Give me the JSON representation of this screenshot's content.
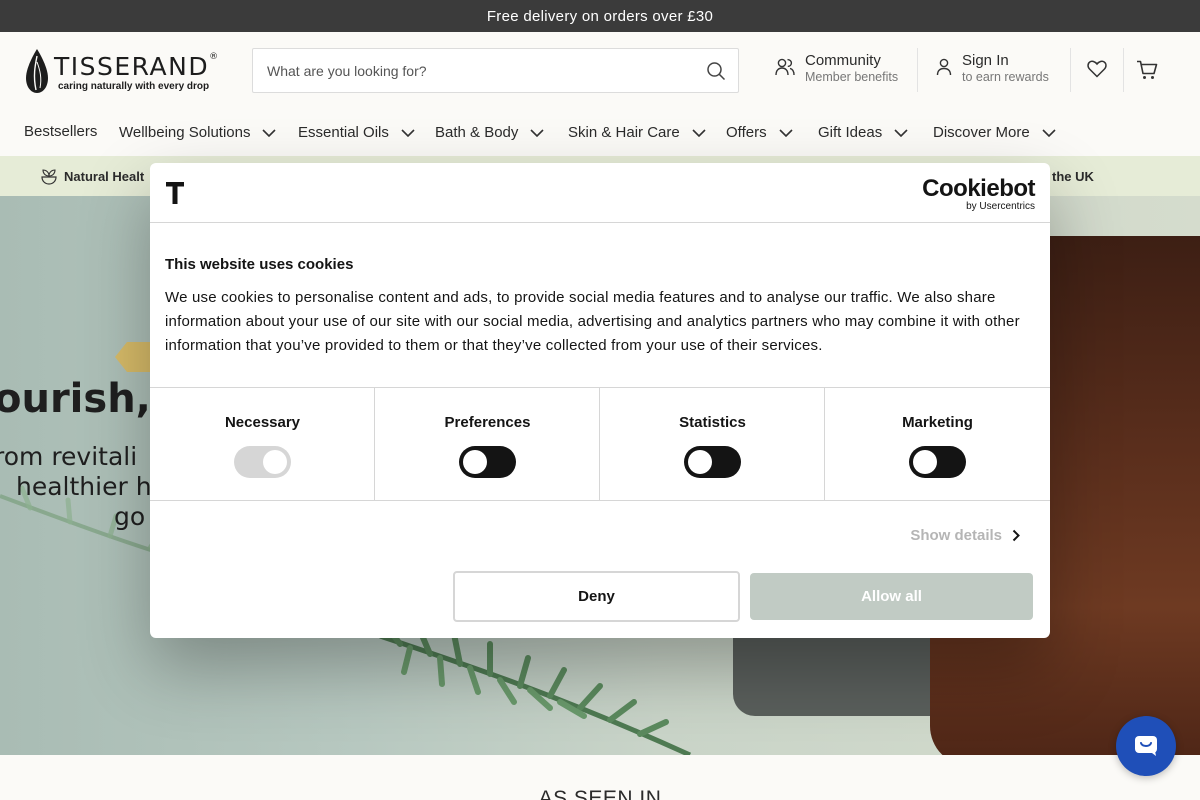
{
  "announcement": "Free delivery on orders over £30",
  "brand": {
    "name": "TISSERAND",
    "registered_mark": "®",
    "tagline": "caring naturally with every drop"
  },
  "search": {
    "placeholder": "What are you looking for?"
  },
  "header_links": {
    "community": {
      "title": "Community",
      "subtitle": "Member benefits"
    },
    "sign_in": {
      "title": "Sign In",
      "subtitle": "to earn rewards"
    }
  },
  "nav": [
    {
      "label": "Bestsellers"
    },
    {
      "label": "Wellbeing Solutions"
    },
    {
      "label": "Essential Oils"
    },
    {
      "label": "Bath & Body"
    },
    {
      "label": "Skin & Hair Care"
    },
    {
      "label": "Offers"
    },
    {
      "label": "Gift Ideas"
    },
    {
      "label": "Discover More"
    }
  ],
  "usp": {
    "left": "Natural Healt",
    "right": "the UK"
  },
  "hero": {
    "title": "ourish,",
    "subtitle_lines": [
      "rom revitali",
      "healthier h",
      "go"
    ]
  },
  "section": {
    "as_seen_in": "AS SEEN IN"
  },
  "cookie_dialog": {
    "provider": {
      "name": "Cookiebot",
      "by": "by Usercentrics"
    },
    "title": "This website uses cookies",
    "body": "We use cookies to personalise content and ads, to provide social media features and to analyse our traffic. We also share information about your use of our site with our social media, advertising and analytics partners who may combine it with other information that you’ve provided to them or that they’ve collected from your use of their services.",
    "categories": [
      {
        "label": "Necessary",
        "checked": true,
        "disabled": true
      },
      {
        "label": "Preferences",
        "checked": false
      },
      {
        "label": "Statistics",
        "checked": false
      },
      {
        "label": "Marketing",
        "checked": false
      }
    ],
    "show_details": "Show details",
    "deny": "Deny",
    "allow_all": "Allow all"
  },
  "colors": {
    "announce_bg": "#3b3b3b",
    "usp_bg": "#e6ecd7",
    "chat_bg": "#1f4fb8",
    "allow_bg": "#c1cbc4",
    "toggle_off": "#141414"
  },
  "icons": [
    "search-icon",
    "community-icon",
    "user-icon",
    "heart-icon",
    "cart-icon",
    "chevron-down-icon",
    "leaf-bowl-icon",
    "chevron-right-icon",
    "chat-icon"
  ]
}
